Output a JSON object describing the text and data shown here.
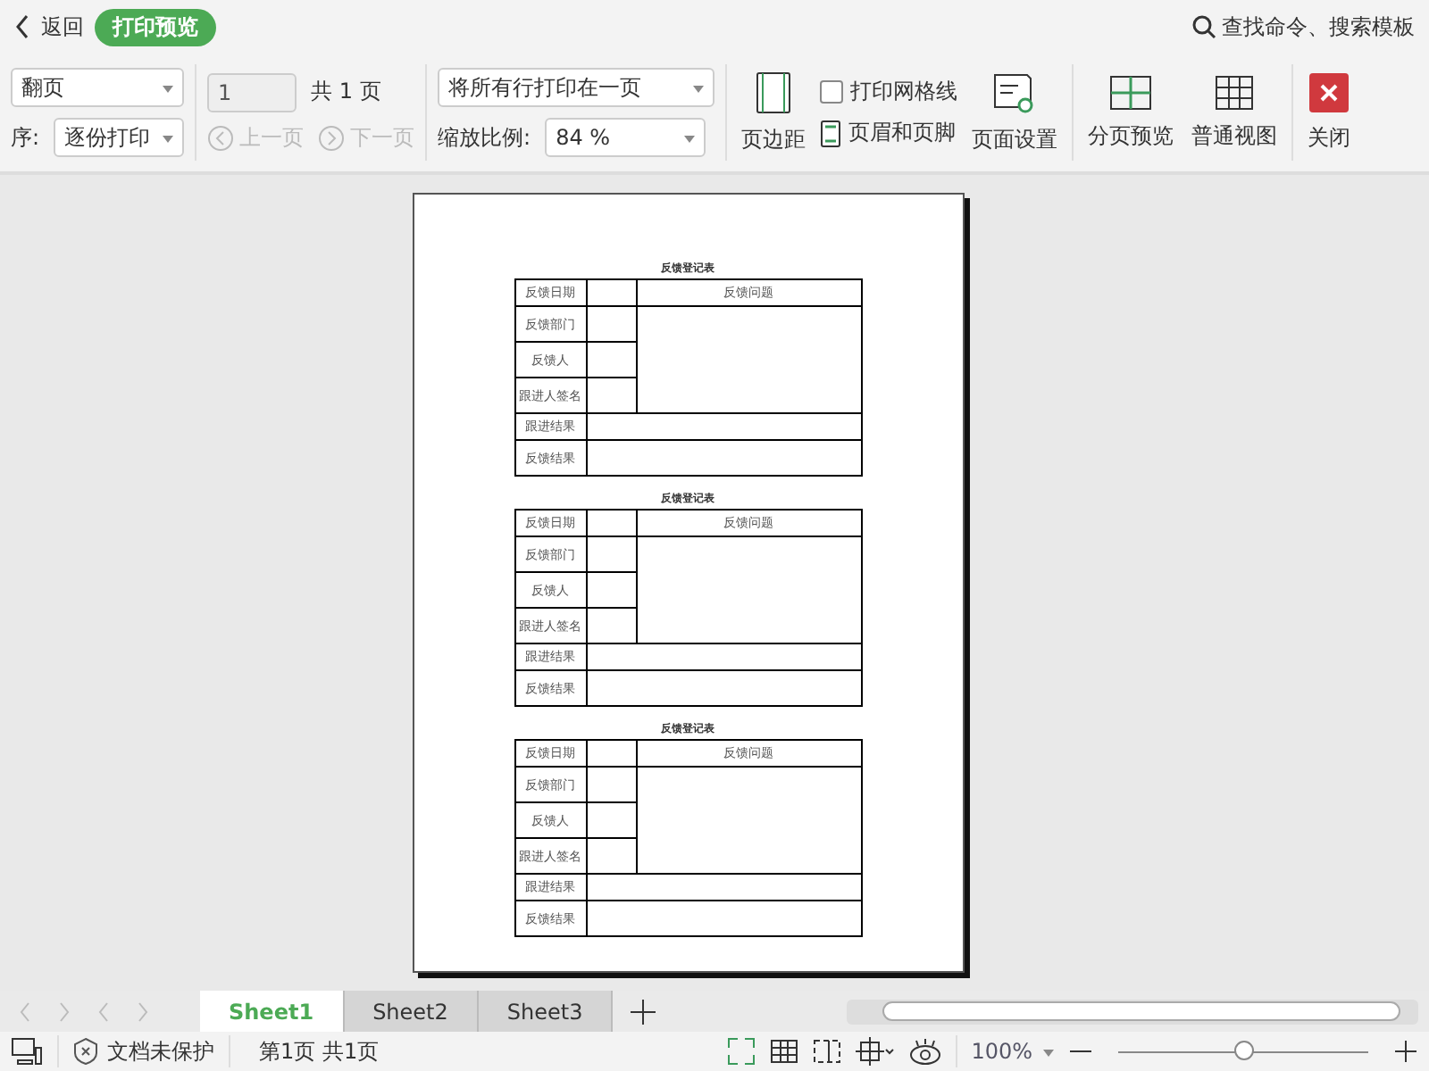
{
  "topbar": {
    "back": "返回",
    "mode_badge": "打印预览",
    "search": "查找命令、搜索模板"
  },
  "toolbar": {
    "page_order_select": "翻页",
    "collate_label": "序:",
    "collate_select": "逐份打印",
    "page_input": "1",
    "page_total": "共 1 页",
    "prev": {
      "label": "上一页",
      "disabled": true
    },
    "next": {
      "label": "下一页",
      "disabled": true
    },
    "fit_select": "将所有行打印在一页",
    "scale_label": "缩放比例:",
    "scale_select": "84 %",
    "margins": "页边距",
    "gridlines": {
      "label": "打印网格线",
      "checked": false
    },
    "header_footer": "页眉和页脚",
    "page_setup": "页面设置",
    "page_break_preview": "分页预览",
    "normal_view": "普通视图",
    "close": "关闭"
  },
  "forms": [
    {
      "title": "反馈登记表",
      "date_label": "反馈日期",
      "issue_label": "反馈问题",
      "rows": [
        "反馈部门",
        "反馈人",
        "跟进人签名"
      ],
      "followup_label": "跟进结果",
      "result_label": "反馈结果"
    },
    {
      "title": "反馈登记表",
      "date_label": "反馈日期",
      "issue_label": "反馈问题",
      "rows": [
        "反馈部门",
        "反馈人",
        "跟进人签名"
      ],
      "followup_label": "跟进结果",
      "result_label": "反馈结果"
    },
    {
      "title": "反馈登记表",
      "date_label": "反馈日期",
      "issue_label": "反馈问题",
      "rows": [
        "反馈部门",
        "反馈人",
        "跟进人签名"
      ],
      "followup_label": "跟进结果",
      "result_label": "反馈结果"
    }
  ],
  "sheet_tabs": [
    {
      "label": "Sheet1",
      "selected": true
    },
    {
      "label": "Sheet2",
      "selected": false
    },
    {
      "label": "Sheet3",
      "selected": false
    }
  ],
  "status_bar": {
    "protection": "文档未保护",
    "page_info": "第1页 共1页",
    "zoom": "100%",
    "zoom_slider": {
      "level": 0.5
    }
  }
}
